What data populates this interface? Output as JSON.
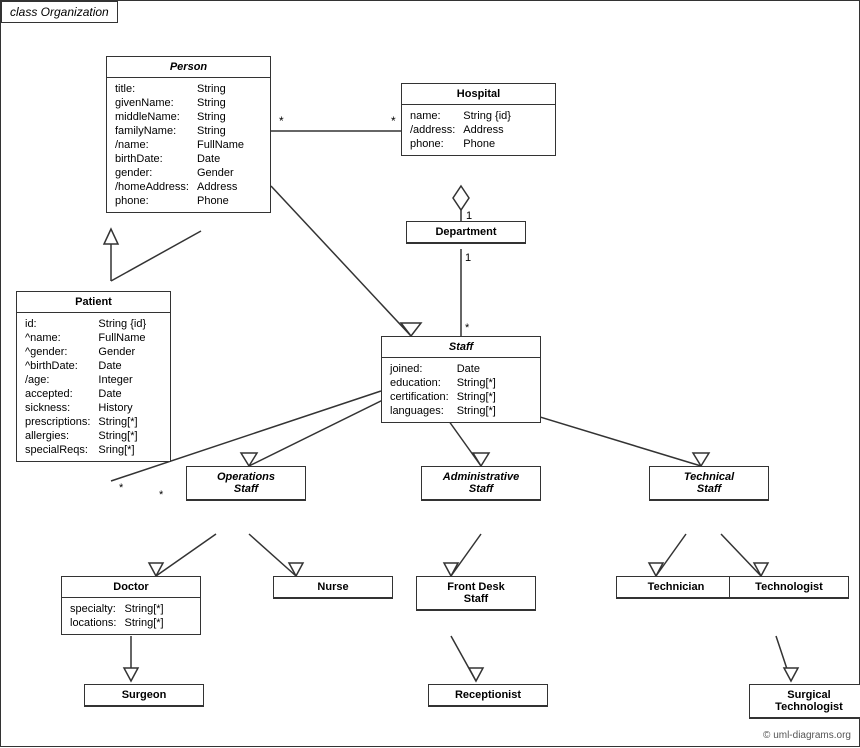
{
  "title": "class Organization",
  "classes": {
    "person": {
      "name": "Person",
      "italic_header": true,
      "attributes": [
        [
          "title:",
          "String"
        ],
        [
          "givenName:",
          "String"
        ],
        [
          "middleName:",
          "String"
        ],
        [
          "familyName:",
          "String"
        ],
        [
          "/name:",
          "FullName"
        ],
        [
          "birthDate:",
          "Date"
        ],
        [
          "gender:",
          "Gender"
        ],
        [
          "/homeAddress:",
          "Address"
        ],
        [
          "phone:",
          "Phone"
        ]
      ]
    },
    "hospital": {
      "name": "Hospital",
      "italic_header": false,
      "attributes": [
        [
          "name:",
          "String {id}"
        ],
        [
          "/address:",
          "Address"
        ],
        [
          "phone:",
          "Phone"
        ]
      ]
    },
    "patient": {
      "name": "Patient",
      "italic_header": false,
      "attributes": [
        [
          "id:",
          "String {id}"
        ],
        [
          "^name:",
          "FullName"
        ],
        [
          "^gender:",
          "Gender"
        ],
        [
          "^birthDate:",
          "Date"
        ],
        [
          "/age:",
          "Integer"
        ],
        [
          "accepted:",
          "Date"
        ],
        [
          "sickness:",
          "History"
        ],
        [
          "prescriptions:",
          "String[*]"
        ],
        [
          "allergies:",
          "String[*]"
        ],
        [
          "specialReqs:",
          "Sring[*]"
        ]
      ]
    },
    "department": {
      "name": "Department",
      "italic_header": false,
      "attributes": []
    },
    "staff": {
      "name": "Staff",
      "italic_header": true,
      "attributes": [
        [
          "joined:",
          "Date"
        ],
        [
          "education:",
          "String[*]"
        ],
        [
          "certification:",
          "String[*]"
        ],
        [
          "languages:",
          "String[*]"
        ]
      ]
    },
    "operations_staff": {
      "name": "Operations\nStaff",
      "italic_header": true,
      "attributes": []
    },
    "administrative_staff": {
      "name": "Administrative\nStaff",
      "italic_header": true,
      "attributes": []
    },
    "technical_staff": {
      "name": "Technical\nStaff",
      "italic_header": true,
      "attributes": []
    },
    "doctor": {
      "name": "Doctor",
      "italic_header": false,
      "attributes": [
        [
          "specialty:",
          "String[*]"
        ],
        [
          "locations:",
          "String[*]"
        ]
      ]
    },
    "nurse": {
      "name": "Nurse",
      "italic_header": false,
      "attributes": []
    },
    "front_desk_staff": {
      "name": "Front Desk\nStaff",
      "italic_header": false,
      "attributes": []
    },
    "technician": {
      "name": "Technician",
      "italic_header": false,
      "attributes": []
    },
    "technologist": {
      "name": "Technologist",
      "italic_header": false,
      "attributes": []
    },
    "surgeon": {
      "name": "Surgeon",
      "italic_header": false,
      "attributes": []
    },
    "receptionist": {
      "name": "Receptionist",
      "italic_header": false,
      "attributes": []
    },
    "surgical_technologist": {
      "name": "Surgical\nTechnologist",
      "italic_header": false,
      "attributes": []
    }
  },
  "copyright": "© uml-diagrams.org"
}
